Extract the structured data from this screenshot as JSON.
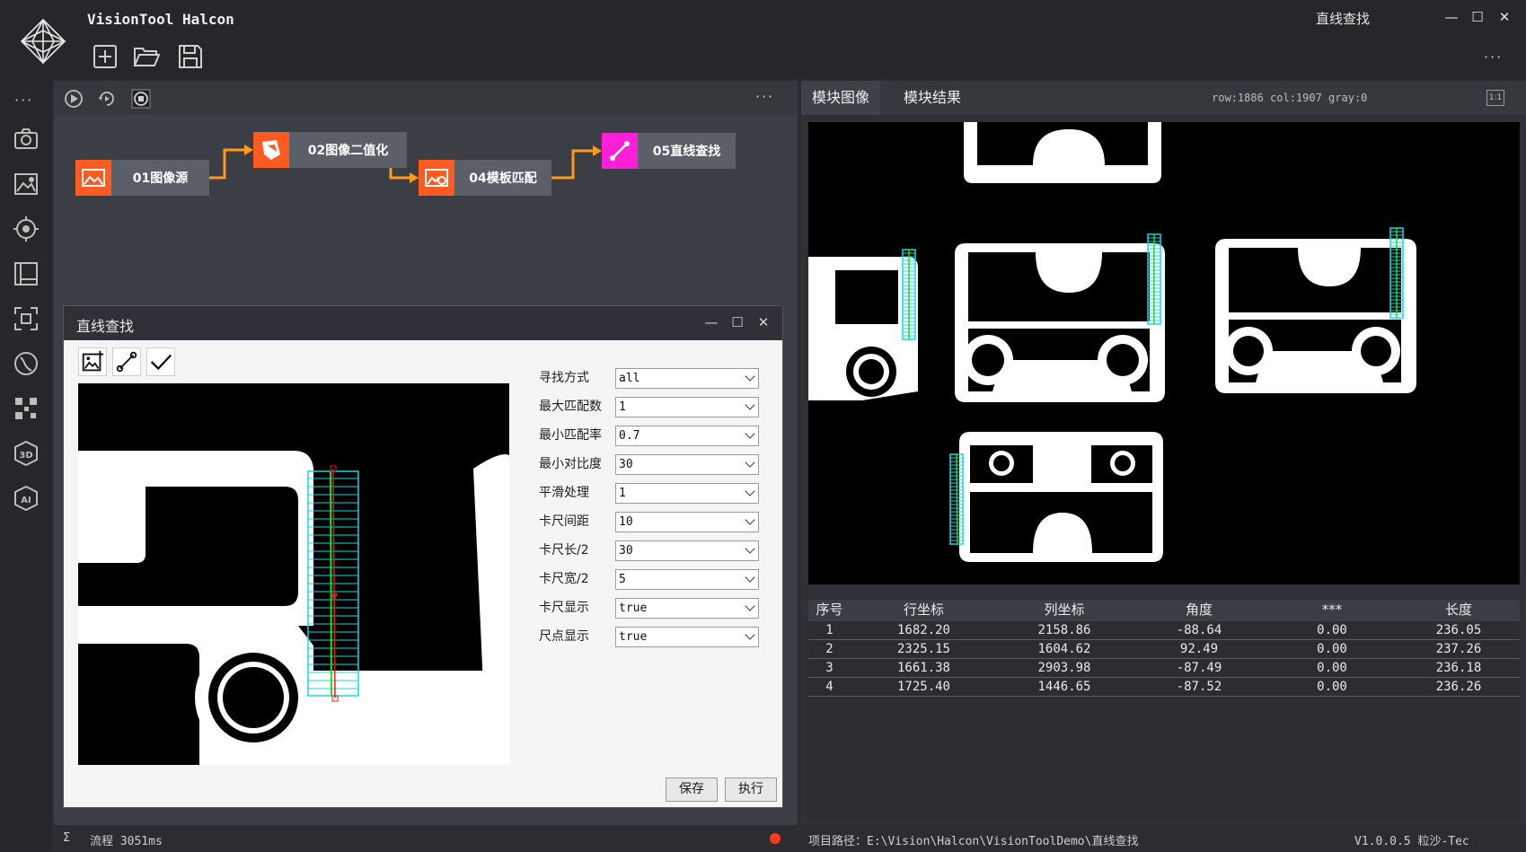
{
  "app": {
    "title": "VisionTool Halcon",
    "window_title": "直线查找",
    "minimize": "—",
    "maximize": "☐",
    "close": "✕",
    "more": "···"
  },
  "flow": {
    "more": "···",
    "nodes": [
      {
        "label": "01图像源",
        "color": "#ff5a1f"
      },
      {
        "label": "02图像二值化",
        "color": "#ff5a1f"
      },
      {
        "label": "04模板匹配",
        "color": "#ff5a1f"
      },
      {
        "label": "05直线查找",
        "color": "#ff1fd8"
      }
    ],
    "connector_color": "#ff9a1a"
  },
  "dialog": {
    "title": "直线查找",
    "minimize": "—",
    "maximize": "☐",
    "close": "✕",
    "params": [
      {
        "label": "寻找方式",
        "value": "all"
      },
      {
        "label": "最大匹配数",
        "value": "1"
      },
      {
        "label": "最小匹配率",
        "value": "0.7"
      },
      {
        "label": "最小对比度",
        "value": "30"
      },
      {
        "label": "平滑处理",
        "value": "1"
      },
      {
        "label": "卡尺间距",
        "value": "10"
      },
      {
        "label": "卡尺长/2",
        "value": "30"
      },
      {
        "label": "卡尺宽/2",
        "value": "5"
      },
      {
        "label": "卡尺显示",
        "value": "true"
      },
      {
        "label": "尺点显示",
        "value": "true"
      }
    ],
    "save_label": "保存",
    "run_label": "执行"
  },
  "right": {
    "tabs": [
      {
        "label": "模块图像"
      },
      {
        "label": "模块结果"
      }
    ],
    "coord_info": "row:1886 col:1907 gray:0",
    "fit_label": "1:1",
    "table": {
      "headers": [
        "序号",
        "行坐标",
        "列坐标",
        "角度",
        "***",
        "长度"
      ],
      "rows": [
        [
          "1",
          "1682.20",
          "2158.86",
          "-88.64",
          "0.00",
          "236.05"
        ],
        [
          "2",
          "2325.15",
          "1604.62",
          "92.49",
          "0.00",
          "237.26"
        ],
        [
          "3",
          "1661.38",
          "2903.98",
          "-87.49",
          "0.00",
          "236.18"
        ],
        [
          "4",
          "1725.40",
          "1446.65",
          "-87.52",
          "0.00",
          "236.26"
        ]
      ]
    }
  },
  "status": {
    "sigma": "Σ",
    "flow_time": "流程 3051ms",
    "project_path": "项目路径：E:\\Vision\\Halcon\\VisionToolDemo\\直线查找",
    "version": "V1.0.0.5 粒沙-Tec"
  },
  "colors": {
    "caliper": "#19d8e6",
    "line_green": "#1de01d",
    "line_red": "#e0201d",
    "status_dot": "#ff3b1f"
  }
}
